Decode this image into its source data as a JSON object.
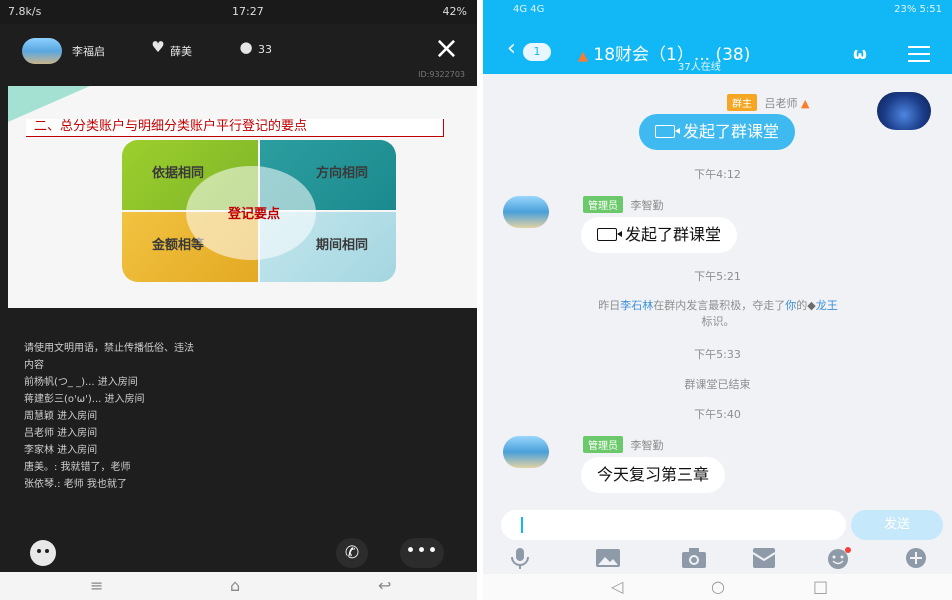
{
  "left": {
    "status": {
      "left": "7.8k/s",
      "time": "17:27",
      "right": "42%"
    },
    "toolbar": {
      "name_1": "李福启",
      "name_2": "薛美",
      "count": "33",
      "room_id": "ID:9322703"
    },
    "slide": {
      "title": "二、总分类账户与明细分类账户平行登记的要点",
      "center": "登记要点",
      "quadrants": [
        "依据相同",
        "方向相同",
        "金额相等",
        "期间相同"
      ]
    },
    "chat_log": [
      "请使用文明用语，禁止传播低俗、违法",
      "内容",
      "前杨帆(つ_ _)... 进入房间",
      "蒋建彭三(o'ω')... 进入房间",
      "周慧颖 进入房间",
      "吕老师 进入房间",
      "李家林 进入房间",
      "唐美。: 我就错了，老师",
      "张依琴.: 老师 我也就了"
    ]
  },
  "right": {
    "status": {
      "left": "4G 4G",
      "right": "23% 5:51"
    },
    "header": {
      "back_badge": "1",
      "group_name": "18财会（1）...",
      "member_count": "(38)",
      "online": "37人在线"
    },
    "messages": {
      "m1_badge": "群主",
      "m1_name": "吕老师",
      "m1_text": "发起了群课堂",
      "t1": "下午4:12",
      "m2_badge": "管理员",
      "m2_name": "李智勤",
      "m2_text": "发起了群课堂",
      "t2": "下午5:21",
      "sys_1a": "昨日",
      "sys_1b": "李石林",
      "sys_1c": "在群内发言最积极，夺走了",
      "sys_1d": "你",
      "sys_1e": "的",
      "sys_1f": "龙王",
      "sys_1g": "标识。",
      "t3": "下午5:33",
      "sys_2": "群课堂已结束",
      "t4": "下午5:40",
      "m3_badge": "管理员",
      "m3_name": "李智勤",
      "m3_text": "今天复习第三章"
    },
    "input": {
      "send": "发送"
    }
  },
  "colors": {
    "qq_blue": "#12b7f5",
    "slide_red": "#c00000",
    "owner_badge": "#f5a623",
    "admin_badge": "#6cc96b"
  }
}
